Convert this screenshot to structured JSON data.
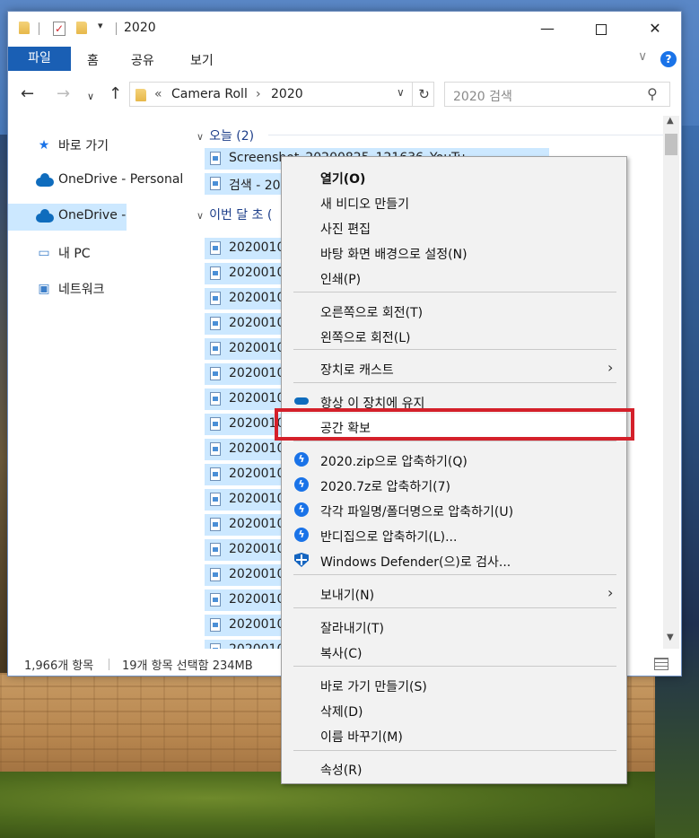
{
  "window": {
    "title": "2020",
    "min_glyph": "—",
    "close_glyph": "✕",
    "qa_dropdown": "▾"
  },
  "ribbon": {
    "tabs": [
      "파일",
      "홈",
      "공유",
      "보기"
    ],
    "collapse_glyph": "∨",
    "help_glyph": "?"
  },
  "nav": {
    "back": "←",
    "forward": "→",
    "recent": "∨",
    "up": "↑",
    "address": {
      "overflow": "«",
      "crumbs": [
        "Camera Roll",
        "2020"
      ],
      "separator": "›",
      "dropdown": "∨",
      "refresh": "↻"
    },
    "search_placeholder": "2020 검색",
    "search_icon": "⚲"
  },
  "navpane": {
    "items": [
      {
        "label": "바로 가기",
        "icon": "star-icon"
      },
      {
        "label": "OneDrive - Personal",
        "icon": "onedrive-icon"
      },
      {
        "label": "OneDrive -",
        "icon": "onedrive-icon",
        "selected": true
      },
      {
        "label": "내 PC",
        "icon": "pc-icon"
      },
      {
        "label": "네트워크",
        "icon": "network-icon"
      }
    ]
  },
  "filepane": {
    "groups": [
      {
        "label": "오늘 (2)",
        "chev": "∨"
      },
      {
        "label": "이번 달 초 (",
        "chev": "∨"
      }
    ],
    "today_files": [
      "Screenshot_20200825_121636_YouTu",
      "검색 - 20"
    ],
    "month_files": [
      "20200108",
      "20200108",
      "20200108",
      "20200108",
      "20200108",
      "20200108",
      "20200108",
      "20200108",
      "20200106",
      "20200108",
      "20200108",
      "20200106",
      "20200107",
      "20200108",
      "20200108",
      "20200108",
      "20200108"
    ]
  },
  "status": {
    "count": "1,966개 항목",
    "selected": "19개 항목 선택함 234MB"
  },
  "scroll": {
    "up": "▲",
    "down": "▼"
  },
  "context_menu": {
    "items": [
      {
        "label": "열기(O)",
        "bold": true
      },
      {
        "label": "새 비디오 만들기"
      },
      {
        "label": "사진 편집"
      },
      {
        "label": "바탕 화면 배경으로 설정(N)"
      },
      {
        "label": "인쇄(P)"
      },
      {
        "label": "오른쪽으로 회전(T)"
      },
      {
        "label": "왼쪽으로 회전(L)"
      },
      {
        "label": "장치로 캐스트",
        "submenu": true
      },
      {
        "label": "항상 이 장치에 유지",
        "icon": "onedrive-icon"
      },
      {
        "label": "공간 확보",
        "highlighted": true
      },
      {
        "label": "2020.zip으로 압축하기(Q)",
        "icon": "bandizip-icon"
      },
      {
        "label": "2020.7z로 압축하기(7)",
        "icon": "bandizip-icon"
      },
      {
        "label": "각각 파일명/폴더명으로 압축하기(U)",
        "icon": "bandizip-icon"
      },
      {
        "label": "반디집으로 압축하기(L)...",
        "icon": "bandizip-icon"
      },
      {
        "label": "Windows Defender(으)로 검사...",
        "icon": "defender-shield-icon"
      },
      {
        "label": "보내기(N)",
        "submenu": true
      },
      {
        "label": "잘라내기(T)"
      },
      {
        "label": "복사(C)"
      },
      {
        "label": "바로 가기 만들기(S)"
      },
      {
        "label": "삭제(D)"
      },
      {
        "label": "이름 바꾸기(M)"
      },
      {
        "label": "속성(R)"
      }
    ],
    "submenu_glyph": "›",
    "bandizip_glyph": "ϟ",
    "highlight_color": "#d4202a"
  },
  "colors": {
    "accent": "#1a5fb4",
    "selection": "#cce8ff",
    "menu_bg": "#f2f2f2"
  }
}
